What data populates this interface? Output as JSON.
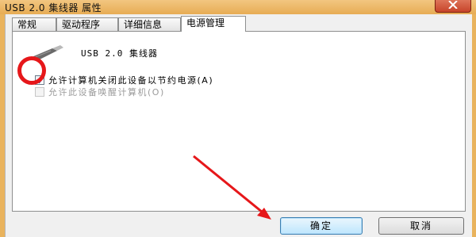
{
  "window": {
    "title": "USB 2.0 集线器 属性"
  },
  "tabs": [
    {
      "label": "常规"
    },
    {
      "label": "驱动程序"
    },
    {
      "label": "详细信息"
    },
    {
      "label": "电源管理"
    }
  ],
  "device": {
    "name": "USB 2.0 集线器",
    "icon": "usb-plug-icon"
  },
  "options": [
    {
      "label": "允许计算机关闭此设备以节约电源(A)",
      "checked": true
    },
    {
      "label": "允许此设备唤醒计算机(O)",
      "checked": false,
      "disabled": true
    }
  ],
  "buttons": {
    "ok": "确定",
    "cancel": "取消"
  },
  "colors": {
    "annotation": "#e6171a",
    "title_bar": "#e9b35d"
  }
}
